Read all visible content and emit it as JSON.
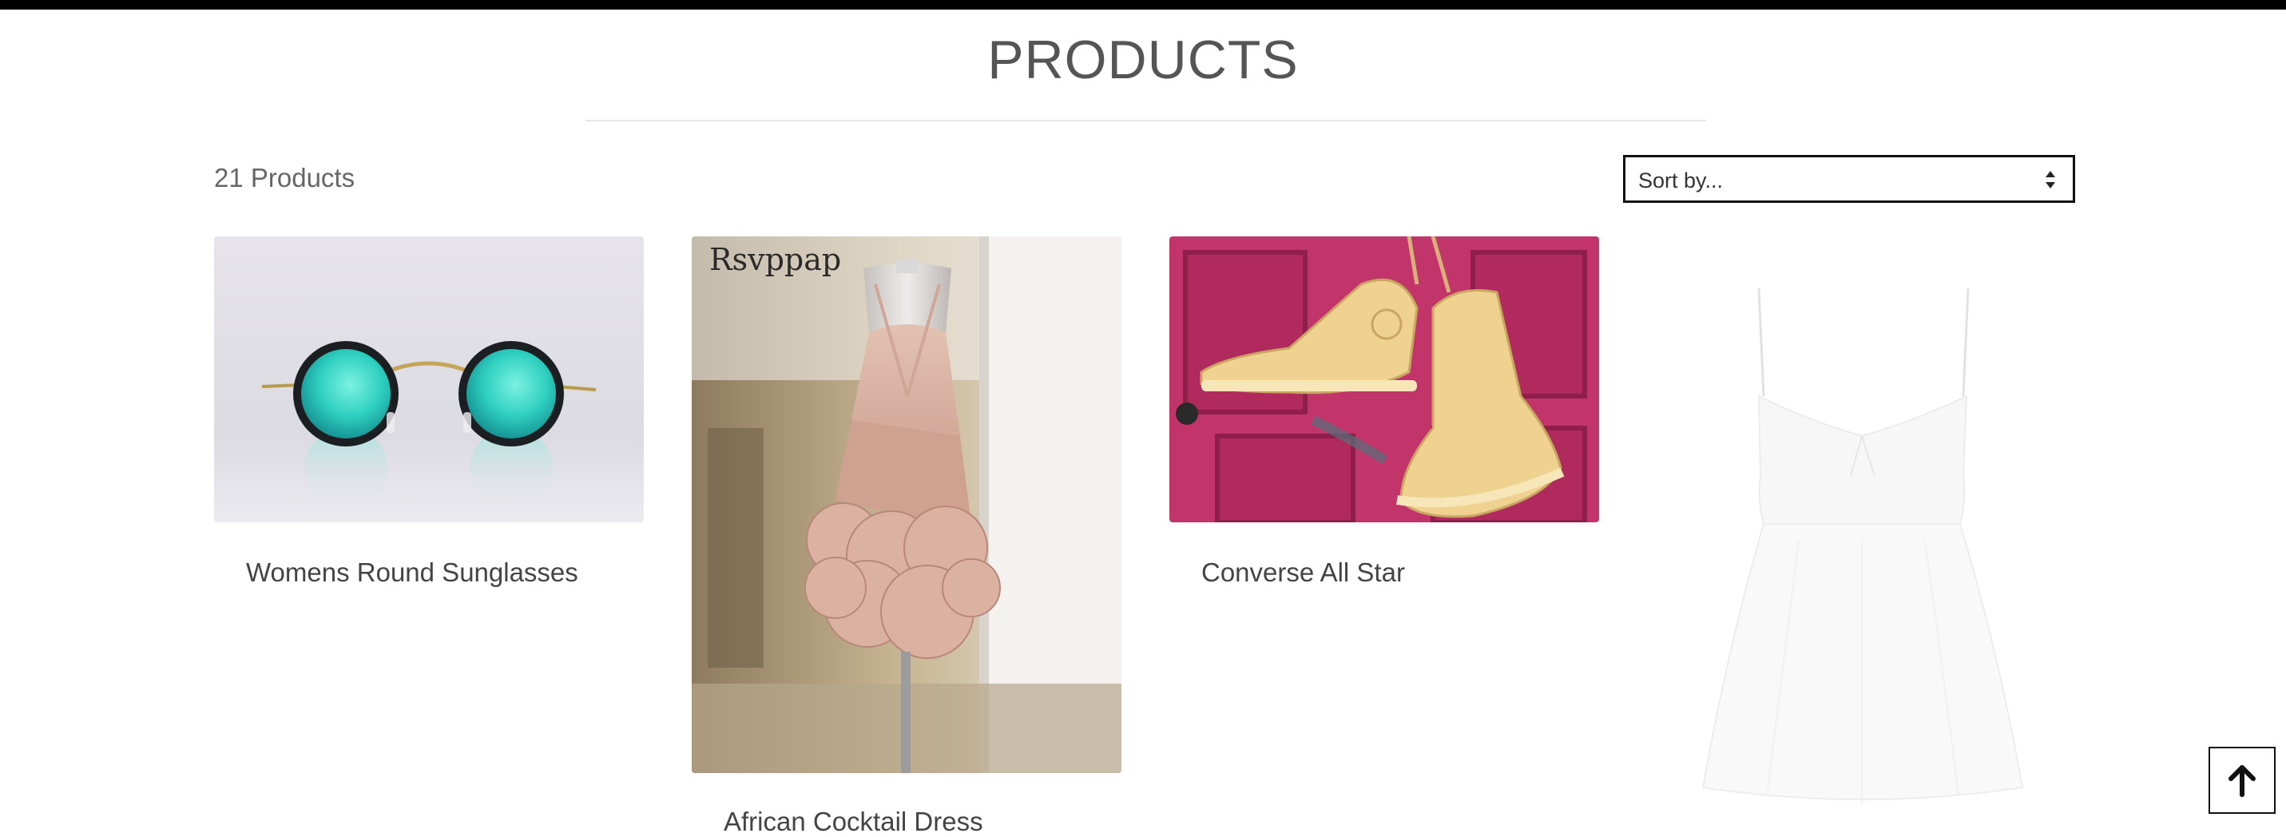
{
  "header": {
    "title": "PRODUCTS"
  },
  "toolbar": {
    "count": "21 Products",
    "sort": {
      "selected": "Sort by..."
    }
  },
  "products": [
    {
      "name": "Womens Round Sunglasses"
    },
    {
      "name": "African Cocktail Dress"
    },
    {
      "name": "Converse All Star"
    },
    {
      "name": ""
    }
  ],
  "image_text": {
    "dress_watermark": "Rsvppap"
  },
  "icons": {
    "sort": "sort-arrows-icon",
    "back_to_top": "arrow-up-icon"
  },
  "colors": {
    "topbar": "#000000",
    "title": "#555555",
    "door": "#c2356b",
    "sneaker": "#efd190",
    "lens": "#2fd0c0",
    "dress_blush": "#d7a896"
  }
}
